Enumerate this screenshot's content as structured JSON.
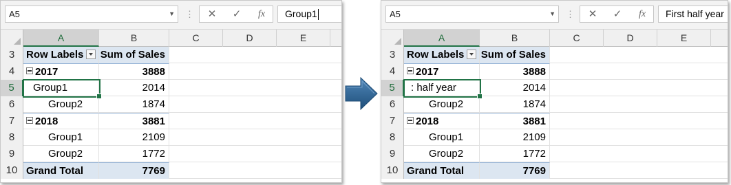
{
  "columns": [
    "A",
    "B",
    "C",
    "D",
    "E"
  ],
  "rows": [
    {
      "n": "3",
      "a": "Row Labels",
      "b": "Sum of Sales",
      "kind": "header"
    },
    {
      "n": "4",
      "a": "2017",
      "b": "3888",
      "kind": "year"
    },
    {
      "n": "5",
      "a": "Group1",
      "b": "2014",
      "kind": "group"
    },
    {
      "n": "6",
      "a": "Group2",
      "b": "1874",
      "kind": "item"
    },
    {
      "n": "7",
      "a": "2018",
      "b": "3881",
      "kind": "year"
    },
    {
      "n": "8",
      "a": "Group1",
      "b": "2109",
      "kind": "item"
    },
    {
      "n": "9",
      "a": "Group2",
      "b": "1772",
      "kind": "item"
    },
    {
      "n": "10",
      "a": "Grand Total",
      "b": "7769",
      "kind": "total"
    }
  ],
  "before": {
    "namebox": "A5",
    "formula": "Group1",
    "active_cell_text": "Group1"
  },
  "after": {
    "namebox": "A5",
    "formula": "First half year",
    "active_cell_text": ": half year"
  },
  "formula_buttons": {
    "cancel": "✕",
    "enter": "✓",
    "fx": "fx"
  },
  "colors": {
    "accent": "#217346",
    "pivot_fill": "#dce6f1",
    "arrow": "#2e6592"
  }
}
